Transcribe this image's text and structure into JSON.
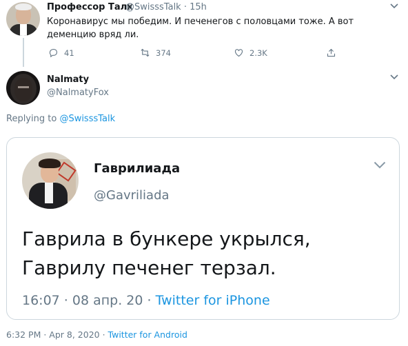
{
  "parent_tweet": {
    "author_name": "Профессор Талк",
    "handle": "@SwisssTalk",
    "time": "15h",
    "text": "Коронавирус мы победим. И печенегов с половцами тоже. А вот деменцию вряд ли.",
    "replies": "41",
    "retweets": "374",
    "likes": "2.3K"
  },
  "reply_tweet": {
    "author_name": "Nalmaty",
    "handle": "@NalmatyFox",
    "replying_prefix": "Replying to ",
    "replying_to": "@SwisssTalk",
    "embedded": {
      "author_name": "Гаврилиада",
      "handle": "@Gavriliada",
      "text_line1": "Гаврила в бункере укрылся,",
      "text_line2": "Гаврилу печенег терзал.",
      "time": "16:07",
      "date": "08 апр. 20",
      "source": "Twitter for iPhone"
    },
    "timestamp": "6:32 PM · Apr 8, 2020",
    "source": "Twitter for Android"
  },
  "icons": [
    "reply-icon",
    "retweet-icon",
    "like-icon",
    "share-icon",
    "chevron-down-icon"
  ],
  "colors": {
    "link": "#1b95e0",
    "secondary": "#657786",
    "text": "#14171a",
    "border": "#ccd6dd"
  }
}
